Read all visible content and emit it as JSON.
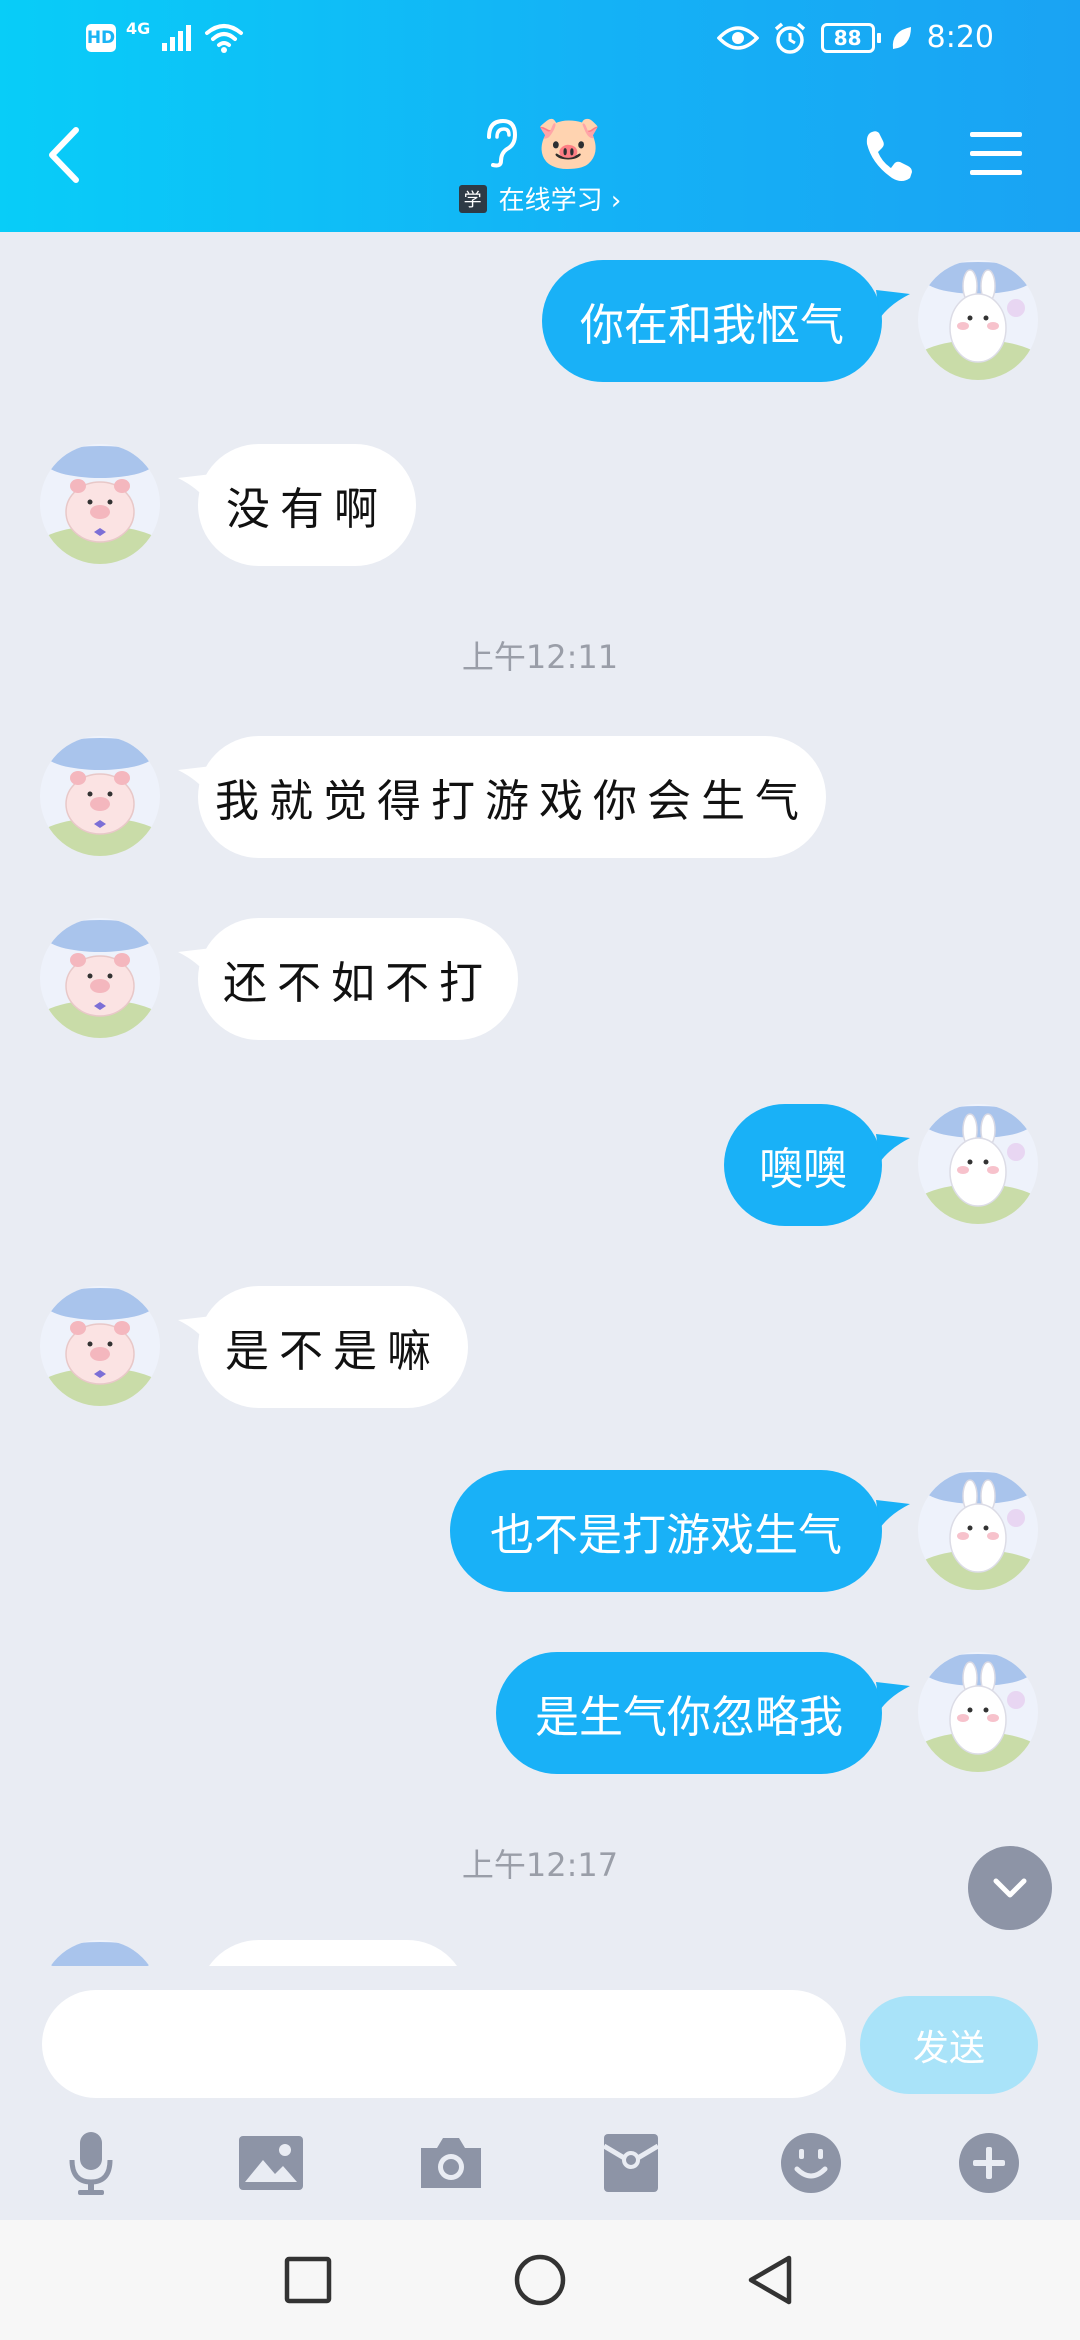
{
  "status_bar": {
    "hd": "HD",
    "network": "4G",
    "battery": "88",
    "time": "8:20"
  },
  "header": {
    "title_emoji": "🐷",
    "status_icon_label": "学",
    "status_text": "在线学习 ›"
  },
  "messages": [
    {
      "side": "out",
      "text": "你在和我怄气"
    },
    {
      "side": "in",
      "text": "没有啊"
    },
    {
      "side": "time",
      "text": "上午12:11"
    },
    {
      "side": "in",
      "text": "我就觉得打游戏你会生气"
    },
    {
      "side": "in",
      "text": "还不如不打"
    },
    {
      "side": "out",
      "text": "噢噢"
    },
    {
      "side": "in",
      "text": "是不是嘛"
    },
    {
      "side": "out",
      "text": "也不是打游戏生气"
    },
    {
      "side": "out",
      "text": "是生气你忽略我"
    },
    {
      "side": "time",
      "text": "上午12:17"
    }
  ],
  "input": {
    "placeholder": "",
    "value": "",
    "send_label": "发送"
  },
  "colors": {
    "accent": "#19b1f7",
    "header_start": "#08cdf8",
    "header_end": "#1aa3f3",
    "chat_bg": "#e9ecf3",
    "toolbar_icon": "#8d94a6"
  },
  "toolbar_icons": [
    "microphone-icon",
    "image-icon",
    "camera-icon",
    "red-packet-icon",
    "emoji-icon",
    "plus-icon"
  ]
}
